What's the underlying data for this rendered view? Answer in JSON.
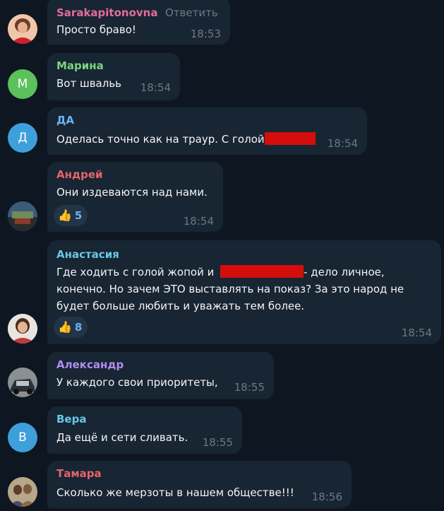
{
  "messages": [
    {
      "author": "Sarakapitonovna",
      "author_color": "#e56c9d",
      "reply_label": "Ответить",
      "text": "Просто браво!",
      "time": "18:53"
    },
    {
      "author": "Марина",
      "author_color": "#7ad67e",
      "avatar_letter": "М",
      "avatar_color": "#5bc15b",
      "text": "Вот швальь",
      "time": "18:54"
    },
    {
      "author": "ДА",
      "author_color": "#6ab3f3",
      "avatar_letter": "Д",
      "avatar_color": "#3ea0db",
      "text": "Оделась точно как  на траур. С голой",
      "time": "18:54"
    },
    {
      "author": "Андрей",
      "author_color": "#e5646b",
      "text": "Они издеваются над нами.",
      "reaction_emoji": "👍",
      "reaction_count": "5",
      "time": "18:54"
    },
    {
      "author": "Анастасия",
      "author_color": "#68c7e6",
      "line1_before": "Где ходить с голой жопой и",
      "line1_after": "- дело личное,",
      "line2": "конечно. Но зачем ЭТО выставлять на показ? За это народ не",
      "line3": "будет больше любить и уважать тем более.",
      "reaction_emoji": "👍",
      "reaction_count": "8",
      "time": "18:54"
    },
    {
      "author": "Александр",
      "author_color": "#b18cf0",
      "text": "У каждого свои приоритеты,",
      "time": "18:55"
    },
    {
      "author": "Вера",
      "author_color": "#68c7e6",
      "avatar_letter": "В",
      "avatar_color": "#3ea0db",
      "text": "Да ещё и сети сливать.",
      "time": "18:55"
    },
    {
      "author": "Тамара",
      "author_color": "#e5646b",
      "text": "Сколько же мерзоты в нашем обществе!!!",
      "time": "18:56"
    }
  ]
}
